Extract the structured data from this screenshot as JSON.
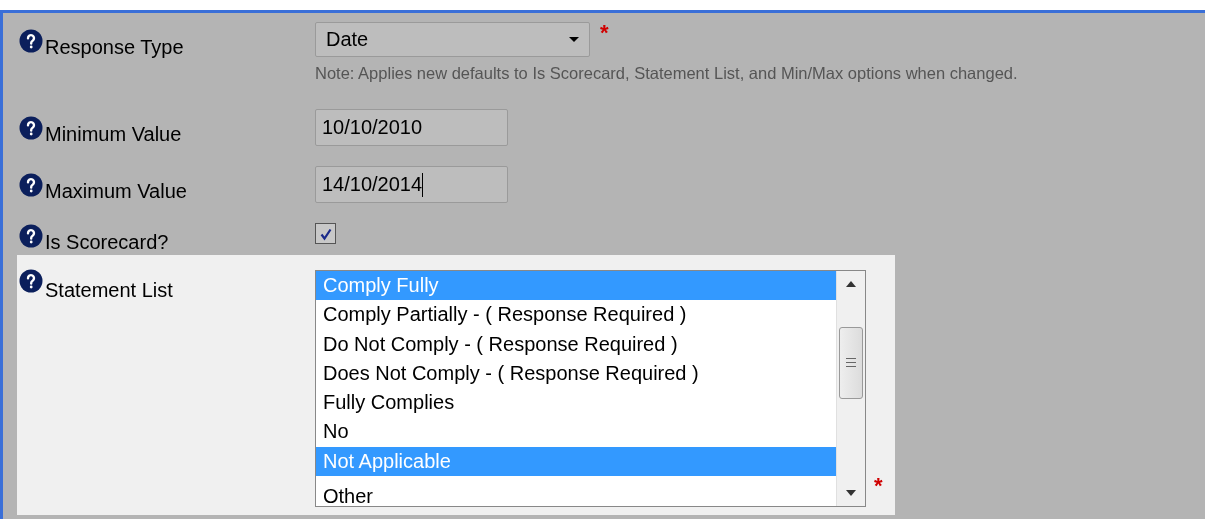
{
  "fields": [
    {
      "kind": "select",
      "label": "Response Type",
      "value": "Date",
      "required_mark": "*",
      "note": "Note: Applies new defaults to Is Scorecard, Statement List, and Min/Max options when changed.",
      "highlighted": false
    },
    {
      "kind": "text",
      "label": "Minimum Value",
      "value": "10/10/2010",
      "focused": false,
      "highlighted": false
    },
    {
      "kind": "text",
      "label": "Maximum Value",
      "value": "14/10/2014",
      "focused": true,
      "highlighted": false
    },
    {
      "kind": "checkbox",
      "label": "Is Scorecard?",
      "checked": true,
      "highlighted": false
    },
    {
      "kind": "listbox",
      "label": "Statement List",
      "required_mark": "*",
      "highlighted": true,
      "options": [
        {
          "label": "Comply Fully",
          "selected": true
        },
        {
          "label": "Comply Partially - ( Response Required )",
          "selected": false
        },
        {
          "label": "Do Not Comply - ( Response Required )",
          "selected": false
        },
        {
          "label": "Does Not Comply - ( Response Required )",
          "selected": false
        },
        {
          "label": "Fully Complies",
          "selected": false
        },
        {
          "label": "No",
          "selected": false
        },
        {
          "label": "Not Applicable",
          "selected": true
        },
        {
          "label": "Other",
          "selected": false
        }
      ]
    }
  ]
}
